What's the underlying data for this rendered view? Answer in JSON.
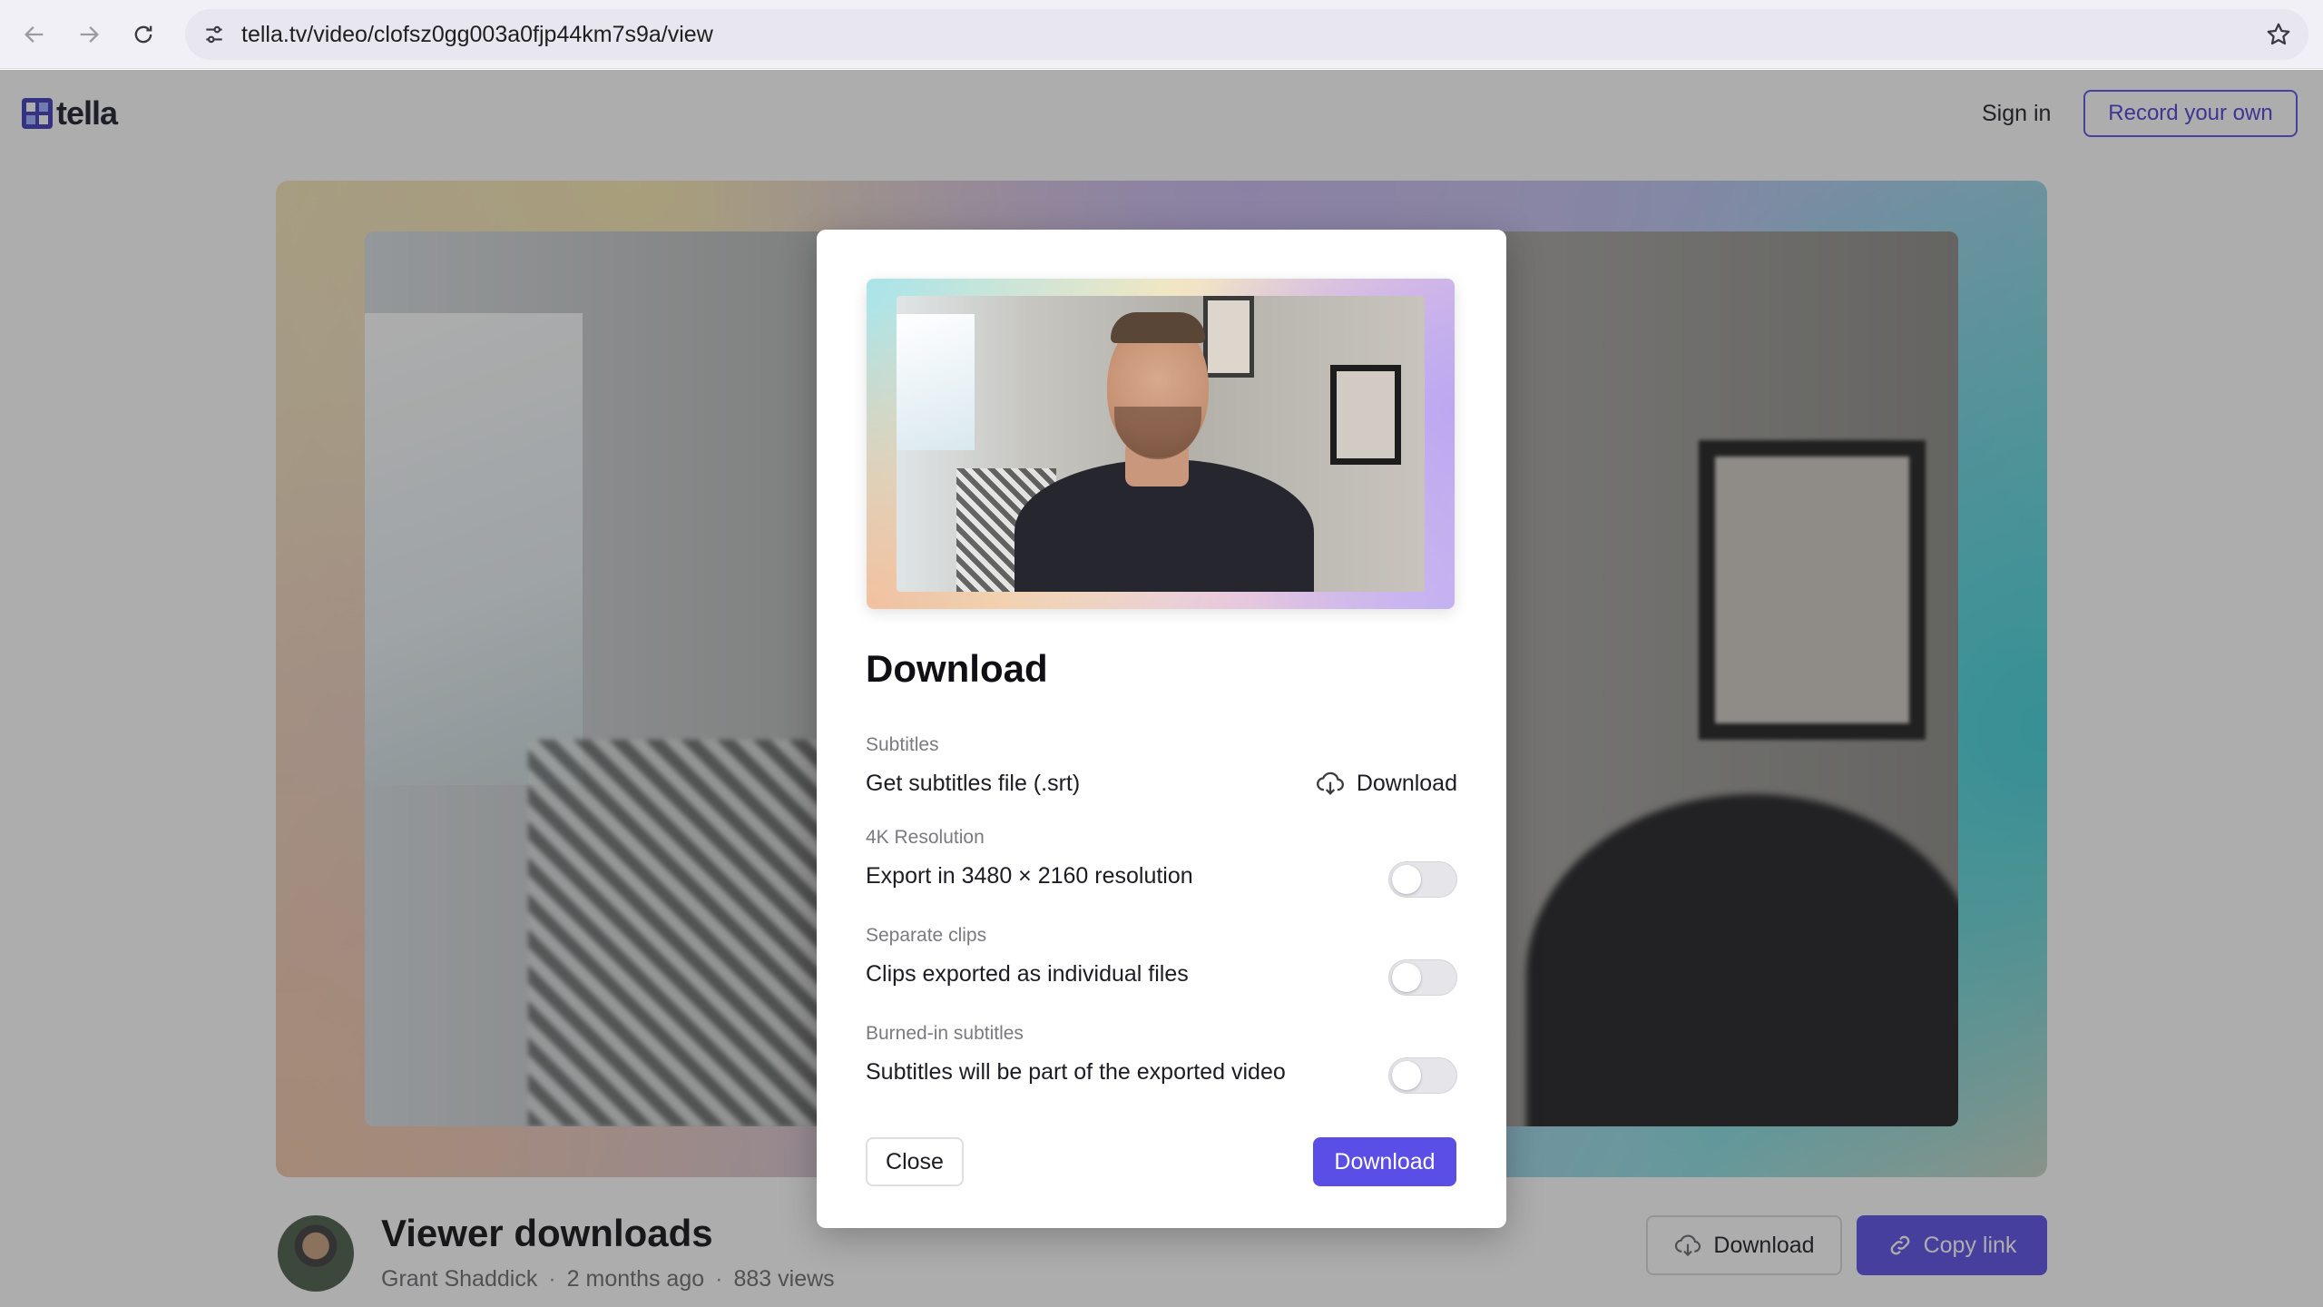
{
  "browser": {
    "url": "tella.tv/video/clofsz0gg003a0fjp44km7s9a/view",
    "back_icon": "arrow-left-icon",
    "forward_icon": "arrow-right-icon",
    "reload_icon": "reload-icon",
    "site_info_icon": "tune-icon",
    "bookmark_icon": "star-icon"
  },
  "header": {
    "logo_text": "tella",
    "sign_in": "Sign in",
    "record_button": "Record your own"
  },
  "video": {
    "title": "Viewer downloads",
    "author": "Grant Shaddick",
    "age": "2 months ago",
    "views": "883 views",
    "separator": "·",
    "download_button": "Download",
    "copy_link_button": "Copy link"
  },
  "modal": {
    "title": "Download",
    "sections": [
      {
        "label": "Subtitles",
        "text": "Get subtitles file (.srt)",
        "action": "Download"
      },
      {
        "label": "4K Resolution",
        "text": "Export in 3480 × 2160 resolution",
        "enabled": false
      },
      {
        "label": "Separate clips",
        "text": "Clips exported as individual files",
        "enabled": false
      },
      {
        "label": "Burned-in subtitles",
        "text": "Subtitles will be part of the exported video",
        "enabled": false
      }
    ],
    "close_button": "Close",
    "download_button": "Download"
  },
  "colors": {
    "accent": "#5b4ee6",
    "overlay": "rgba(40,40,40,0.38)",
    "toggle_off": "#e5e5ea"
  }
}
